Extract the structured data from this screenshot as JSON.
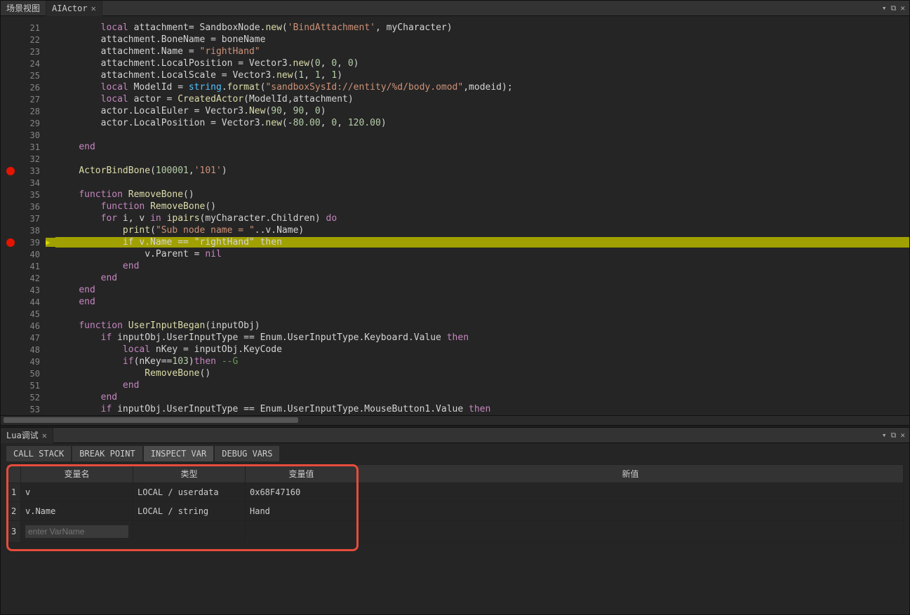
{
  "tabs": {
    "scene": "场景视图",
    "actor": "AIActor"
  },
  "window_icons": {
    "dropdown": "▾",
    "restore": "⧉",
    "close": "✕"
  },
  "code": [
    {
      "n": 21,
      "bp": false,
      "arrow": false,
      "hl": false,
      "tokens": [
        [
          "id",
          "        "
        ],
        [
          "k",
          "local"
        ],
        [
          "id",
          " attachment= SandboxNode."
        ],
        [
          "f",
          "new"
        ],
        [
          "p",
          "("
        ],
        [
          "s",
          "'BindAttachment'"
        ],
        [
          "p",
          ", myCharacter)"
        ]
      ]
    },
    {
      "n": 22,
      "bp": false,
      "arrow": false,
      "hl": false,
      "tokens": [
        [
          "id",
          "        attachment.BoneName = boneName"
        ]
      ]
    },
    {
      "n": 23,
      "bp": false,
      "arrow": false,
      "hl": false,
      "tokens": [
        [
          "id",
          "        attachment.Name = "
        ],
        [
          "s",
          "\"rightHand\""
        ]
      ]
    },
    {
      "n": 24,
      "bp": false,
      "arrow": false,
      "hl": false,
      "tokens": [
        [
          "id",
          "        attachment.LocalPosition = Vector3."
        ],
        [
          "f",
          "new"
        ],
        [
          "p",
          "("
        ],
        [
          "num",
          "0"
        ],
        [
          "p",
          ", "
        ],
        [
          "num",
          "0"
        ],
        [
          "p",
          ", "
        ],
        [
          "num",
          "0"
        ],
        [
          "p",
          ")"
        ]
      ]
    },
    {
      "n": 25,
      "bp": false,
      "arrow": false,
      "hl": false,
      "tokens": [
        [
          "id",
          "        attachment.LocalScale = Vector3."
        ],
        [
          "f",
          "new"
        ],
        [
          "p",
          "("
        ],
        [
          "num",
          "1"
        ],
        [
          "p",
          ", "
        ],
        [
          "num",
          "1"
        ],
        [
          "p",
          ", "
        ],
        [
          "num",
          "1"
        ],
        [
          "p",
          ")"
        ]
      ]
    },
    {
      "n": 26,
      "bp": false,
      "arrow": false,
      "hl": false,
      "tokens": [
        [
          "id",
          "        "
        ],
        [
          "k",
          "local"
        ],
        [
          "id",
          " ModelId = "
        ],
        [
          "lib",
          "string"
        ],
        [
          "p",
          "."
        ],
        [
          "f",
          "format"
        ],
        [
          "p",
          "("
        ],
        [
          "s",
          "\"sandboxSysId://entity/%d/body.omod\""
        ],
        [
          "p",
          ",modeid);"
        ]
      ]
    },
    {
      "n": 27,
      "bp": false,
      "arrow": false,
      "hl": false,
      "tokens": [
        [
          "id",
          "        "
        ],
        [
          "k",
          "local"
        ],
        [
          "id",
          " actor = "
        ],
        [
          "f",
          "CreatedActor"
        ],
        [
          "p",
          "(ModelId,attachment)"
        ]
      ]
    },
    {
      "n": 28,
      "bp": false,
      "arrow": false,
      "hl": false,
      "tokens": [
        [
          "id",
          "        actor.LocalEuler = Vector3."
        ],
        [
          "f",
          "New"
        ],
        [
          "p",
          "("
        ],
        [
          "num",
          "90"
        ],
        [
          "p",
          ", "
        ],
        [
          "num",
          "90"
        ],
        [
          "p",
          ", "
        ],
        [
          "num",
          "0"
        ],
        [
          "p",
          ")"
        ]
      ]
    },
    {
      "n": 29,
      "bp": false,
      "arrow": false,
      "hl": false,
      "tokens": [
        [
          "id",
          "        actor.LocalPosition = Vector3."
        ],
        [
          "f",
          "new"
        ],
        [
          "p",
          "(-"
        ],
        [
          "num",
          "80.00"
        ],
        [
          "p",
          ", "
        ],
        [
          "num",
          "0"
        ],
        [
          "p",
          ", "
        ],
        [
          "num",
          "120.00"
        ],
        [
          "p",
          ")"
        ]
      ]
    },
    {
      "n": 30,
      "bp": false,
      "arrow": false,
      "hl": false,
      "tokens": []
    },
    {
      "n": 31,
      "bp": false,
      "arrow": false,
      "hl": false,
      "tokens": [
        [
          "id",
          "    "
        ],
        [
          "k",
          "end"
        ]
      ]
    },
    {
      "n": 32,
      "bp": false,
      "arrow": false,
      "hl": false,
      "tokens": []
    },
    {
      "n": 33,
      "bp": true,
      "arrow": false,
      "hl": false,
      "tokens": [
        [
          "id",
          "    "
        ],
        [
          "f",
          "ActorBindBone"
        ],
        [
          "p",
          "("
        ],
        [
          "num",
          "100001"
        ],
        [
          "p",
          ","
        ],
        [
          "s",
          "'101'"
        ],
        [
          "p",
          ")"
        ]
      ]
    },
    {
      "n": 34,
      "bp": false,
      "arrow": false,
      "hl": false,
      "tokens": []
    },
    {
      "n": 35,
      "bp": false,
      "arrow": false,
      "hl": false,
      "tokens": [
        [
          "id",
          "    "
        ],
        [
          "k",
          "function"
        ],
        [
          "id",
          " "
        ],
        [
          "f",
          "RemoveBone"
        ],
        [
          "p",
          "()"
        ]
      ]
    },
    {
      "n": 36,
      "bp": false,
      "arrow": false,
      "hl": false,
      "tokens": [
        [
          "id",
          "        "
        ],
        [
          "k",
          "function"
        ],
        [
          "id",
          " "
        ],
        [
          "f",
          "RemoveBone"
        ],
        [
          "p",
          "()"
        ]
      ]
    },
    {
      "n": 37,
      "bp": false,
      "arrow": false,
      "hl": false,
      "tokens": [
        [
          "id",
          "        "
        ],
        [
          "k",
          "for"
        ],
        [
          "id",
          " i, v "
        ],
        [
          "k",
          "in"
        ],
        [
          "id",
          " "
        ],
        [
          "f",
          "ipairs"
        ],
        [
          "p",
          "(myCharacter.Children) "
        ],
        [
          "k",
          "do"
        ]
      ]
    },
    {
      "n": 38,
      "bp": false,
      "arrow": false,
      "hl": false,
      "tokens": [
        [
          "id",
          "            "
        ],
        [
          "f",
          "print"
        ],
        [
          "p",
          "("
        ],
        [
          "s",
          "\"Sub node name = \""
        ],
        [
          "p",
          "..v.Name)"
        ]
      ]
    },
    {
      "n": 39,
      "bp": true,
      "arrow": true,
      "hl": true,
      "tokens": [
        [
          "id",
          "            "
        ],
        [
          "k",
          "if"
        ],
        [
          "id",
          " v.Name == "
        ],
        [
          "s",
          "\"rightHand\""
        ],
        [
          "id",
          " "
        ],
        [
          "k",
          "then"
        ]
      ]
    },
    {
      "n": 40,
      "bp": false,
      "arrow": false,
      "hl": false,
      "tokens": [
        [
          "id",
          "                v.Parent = "
        ],
        [
          "k",
          "nil"
        ]
      ]
    },
    {
      "n": 41,
      "bp": false,
      "arrow": false,
      "hl": false,
      "tokens": [
        [
          "id",
          "            "
        ],
        [
          "k",
          "end"
        ]
      ]
    },
    {
      "n": 42,
      "bp": false,
      "arrow": false,
      "hl": false,
      "tokens": [
        [
          "id",
          "        "
        ],
        [
          "k",
          "end"
        ]
      ]
    },
    {
      "n": 43,
      "bp": false,
      "arrow": false,
      "hl": false,
      "tokens": [
        [
          "id",
          "    "
        ],
        [
          "k",
          "end"
        ]
      ]
    },
    {
      "n": 44,
      "bp": false,
      "arrow": false,
      "hl": false,
      "tokens": [
        [
          "id",
          "    "
        ],
        [
          "k",
          "end"
        ]
      ]
    },
    {
      "n": 45,
      "bp": false,
      "arrow": false,
      "hl": false,
      "tokens": []
    },
    {
      "n": 46,
      "bp": false,
      "arrow": false,
      "hl": false,
      "tokens": [
        [
          "id",
          "    "
        ],
        [
          "k",
          "function"
        ],
        [
          "id",
          " "
        ],
        [
          "f",
          "UserInputBegan"
        ],
        [
          "p",
          "(inputObj)"
        ]
      ]
    },
    {
      "n": 47,
      "bp": false,
      "arrow": false,
      "hl": false,
      "tokens": [
        [
          "id",
          "        "
        ],
        [
          "k",
          "if"
        ],
        [
          "id",
          " inputObj.UserInputType == Enum.UserInputType.Keyboard.Value "
        ],
        [
          "k",
          "then"
        ]
      ]
    },
    {
      "n": 48,
      "bp": false,
      "arrow": false,
      "hl": false,
      "tokens": [
        [
          "id",
          "            "
        ],
        [
          "k",
          "local"
        ],
        [
          "id",
          " nKey = inputObj.KeyCode"
        ]
      ]
    },
    {
      "n": 49,
      "bp": false,
      "arrow": false,
      "hl": false,
      "tokens": [
        [
          "id",
          "            "
        ],
        [
          "k",
          "if"
        ],
        [
          "p",
          "(nKey=="
        ],
        [
          "num",
          "103"
        ],
        [
          "p",
          ")"
        ],
        [
          "k",
          "then"
        ],
        [
          "id",
          " "
        ],
        [
          "c",
          "--G"
        ]
      ]
    },
    {
      "n": 50,
      "bp": false,
      "arrow": false,
      "hl": false,
      "tokens": [
        [
          "id",
          "                "
        ],
        [
          "f",
          "RemoveBone"
        ],
        [
          "p",
          "()"
        ]
      ]
    },
    {
      "n": 51,
      "bp": false,
      "arrow": false,
      "hl": false,
      "tokens": [
        [
          "id",
          "            "
        ],
        [
          "k",
          "end"
        ]
      ]
    },
    {
      "n": 52,
      "bp": false,
      "arrow": false,
      "hl": false,
      "tokens": [
        [
          "id",
          "        "
        ],
        [
          "k",
          "end"
        ]
      ]
    },
    {
      "n": 53,
      "bp": false,
      "arrow": false,
      "hl": false,
      "tokens": [
        [
          "id",
          "        "
        ],
        [
          "k",
          "if"
        ],
        [
          "id",
          " inputObj.UserInputType == Enum.UserInputType.MouseButton1.Value "
        ],
        [
          "k",
          "then"
        ]
      ]
    }
  ],
  "debug": {
    "title": "Lua调试",
    "tabs": [
      "CALL STACK",
      "BREAK POINT",
      "INSPECT VAR",
      "DEBUG VARS"
    ],
    "active_tab": 2,
    "headers": {
      "name": "变量名",
      "type": "类型",
      "value": "变量值",
      "newvalue": "新值"
    },
    "rows": [
      {
        "i": "1",
        "name": "v",
        "type": "LOCAL / userdata",
        "value": "0x68F47160"
      },
      {
        "i": "2",
        "name": "v.Name",
        "type": "LOCAL / string",
        "value": "Hand"
      }
    ],
    "entry_row_index": "3",
    "entry_placeholder": "enter VarName"
  }
}
